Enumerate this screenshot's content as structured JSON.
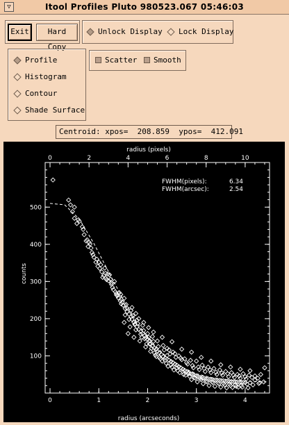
{
  "window": {
    "title": "Itool Profiles Pluto  980523.067 05:46:03",
    "menu_glyph": "▽"
  },
  "toolbar": {
    "exit_label": "Exit",
    "hardcopy_label": "Hard Copy",
    "unlock_label": "Unlock Display",
    "lock_label": "Lock Display"
  },
  "plot_types": [
    {
      "label": "Profile",
      "selected": true
    },
    {
      "label": "Histogram",
      "selected": false
    },
    {
      "label": "Contour",
      "selected": false
    },
    {
      "label": "Shade Surface",
      "selected": false
    }
  ],
  "options": {
    "scatter_label": "Scatter",
    "smooth_label": "Smooth"
  },
  "centroid": {
    "label": "Centroid:",
    "xpos_label": "xpos=",
    "xpos": "208.859",
    "ypos_label": "ypos=",
    "ypos": "412.091"
  },
  "chart_data": {
    "type": "scatter",
    "xlabel": "radius (arcseconds)",
    "ylabel": "counts",
    "top_xlabel": "radius (pixels)",
    "xlim": [
      -0.1,
      4.5
    ],
    "ylim": [
      0,
      620
    ],
    "x_ticks": [
      "0",
      "1",
      "2",
      "3",
      "4"
    ],
    "top_x_ticks": [
      "0",
      "2",
      "4",
      "6",
      "8",
      "10"
    ],
    "y_ticks": [
      "100",
      "200",
      "300",
      "400",
      "500"
    ],
    "annotations": [
      {
        "label": "FWHM(pixels):",
        "value": "6.34"
      },
      {
        "label": "FWHM(arcsec):",
        "value": "2.54"
      }
    ],
    "series": [
      {
        "points": [
          [
            0.06,
            573
          ],
          [
            0.38,
            519
          ],
          [
            0.42,
            506
          ],
          [
            0.46,
            488
          ],
          [
            0.5,
            470
          ],
          [
            0.55,
            456
          ],
          [
            0.6,
            462
          ],
          [
            0.66,
            447
          ],
          [
            0.7,
            426
          ],
          [
            0.74,
            409
          ],
          [
            0.78,
            394
          ],
          [
            0.82,
            401
          ],
          [
            0.86,
            378
          ],
          [
            0.88,
            372
          ],
          [
            0.9,
            365
          ],
          [
            0.94,
            352
          ],
          [
            0.98,
            341
          ],
          [
            1.02,
            335
          ],
          [
            1.06,
            326
          ],
          [
            1.1,
            316
          ],
          [
            1.14,
            309
          ],
          [
            1.16,
            305
          ],
          [
            1.2,
            302
          ],
          [
            1.22,
            318
          ],
          [
            1.26,
            296
          ],
          [
            1.3,
            278
          ],
          [
            1.34,
            272
          ],
          [
            1.36,
            264
          ],
          [
            1.4,
            256
          ],
          [
            1.44,
            248
          ],
          [
            1.46,
            240
          ],
          [
            1.5,
            236
          ],
          [
            1.54,
            227
          ],
          [
            1.58,
            219
          ],
          [
            1.62,
            212
          ],
          [
            1.66,
            206
          ],
          [
            1.68,
            198
          ],
          [
            1.72,
            190
          ],
          [
            1.74,
            184
          ],
          [
            1.78,
            178
          ],
          [
            1.82,
            171
          ],
          [
            1.86,
            166
          ],
          [
            1.9,
            160
          ],
          [
            1.94,
            154
          ],
          [
            1.96,
            149
          ],
          [
            2.0,
            144
          ],
          [
            2.04,
            141
          ],
          [
            2.06,
            132
          ],
          [
            2.1,
            126
          ],
          [
            2.14,
            121
          ],
          [
            2.18,
            118
          ],
          [
            2.2,
            112
          ],
          [
            2.24,
            108
          ],
          [
            2.28,
            104
          ],
          [
            2.32,
            98
          ],
          [
            2.36,
            94
          ],
          [
            2.4,
            101
          ],
          [
            2.44,
            88
          ],
          [
            2.48,
            85
          ],
          [
            2.52,
            82
          ],
          [
            2.56,
            78
          ],
          [
            2.6,
            75
          ],
          [
            2.64,
            71
          ],
          [
            2.68,
            68
          ],
          [
            2.72,
            64
          ],
          [
            2.76,
            60
          ],
          [
            2.8,
            58
          ],
          [
            2.84,
            55
          ],
          [
            2.88,
            52
          ],
          [
            2.92,
            50
          ],
          [
            2.96,
            48
          ],
          [
            3.0,
            46
          ],
          [
            3.04,
            44
          ],
          [
            3.08,
            42
          ],
          [
            3.12,
            41
          ],
          [
            3.16,
            40
          ],
          [
            3.2,
            38
          ],
          [
            3.24,
            38
          ],
          [
            3.28,
            37
          ],
          [
            3.32,
            36
          ],
          [
            3.36,
            35
          ],
          [
            3.4,
            35
          ],
          [
            3.44,
            34
          ],
          [
            3.48,
            34
          ],
          [
            3.52,
            33
          ],
          [
            3.56,
            33
          ],
          [
            3.6,
            32
          ],
          [
            3.64,
            32
          ],
          [
            3.68,
            31
          ],
          [
            3.72,
            31
          ],
          [
            3.76,
            30
          ],
          [
            3.8,
            30
          ],
          [
            3.84,
            30
          ],
          [
            3.88,
            29
          ],
          [
            3.92,
            29
          ],
          [
            3.96,
            29
          ],
          [
            4.0,
            28
          ],
          [
            4.1,
            28
          ],
          [
            4.3,
            28
          ],
          [
            0.58,
            466
          ],
          [
            0.76,
            412
          ],
          [
            0.96,
            360
          ],
          [
            1.08,
            311
          ],
          [
            1.18,
            320
          ],
          [
            1.28,
            284
          ],
          [
            1.38,
            262
          ],
          [
            1.48,
            244
          ],
          [
            1.58,
            228
          ],
          [
            1.7,
            208
          ],
          [
            1.8,
            187
          ],
          [
            1.92,
            168
          ],
          [
            2.02,
            150
          ],
          [
            2.12,
            139
          ],
          [
            2.22,
            125
          ],
          [
            2.34,
            116
          ],
          [
            2.46,
            105
          ],
          [
            2.58,
            96
          ],
          [
            2.7,
            90
          ],
          [
            2.82,
            78
          ],
          [
            2.94,
            68
          ],
          [
            3.06,
            63
          ],
          [
            3.18,
            58
          ],
          [
            3.3,
            55
          ],
          [
            3.42,
            50
          ],
          [
            3.54,
            48
          ],
          [
            3.66,
            44
          ],
          [
            3.78,
            42
          ],
          [
            3.9,
            40
          ],
          [
            4.02,
            38
          ],
          [
            4.2,
            35
          ],
          [
            1.52,
            190
          ],
          [
            1.64,
            178
          ],
          [
            1.76,
            170
          ],
          [
            1.88,
            150
          ],
          [
            1.98,
            132
          ],
          [
            2.08,
            120
          ],
          [
            2.16,
            102
          ],
          [
            2.26,
            92
          ],
          [
            2.38,
            80
          ],
          [
            2.5,
            70
          ],
          [
            2.62,
            60
          ],
          [
            2.74,
            50
          ],
          [
            2.86,
            45
          ],
          [
            2.98,
            40
          ],
          [
            3.1,
            36
          ],
          [
            3.22,
            30
          ],
          [
            3.34,
            28
          ],
          [
            3.46,
            25
          ],
          [
            3.58,
            22
          ],
          [
            3.7,
            20
          ],
          [
            3.82,
            18
          ],
          [
            3.94,
            16
          ],
          [
            4.06,
            14
          ],
          [
            1.6,
            160
          ],
          [
            1.72,
            150
          ],
          [
            1.84,
            140
          ],
          [
            1.96,
            124
          ],
          [
            2.06,
            112
          ],
          [
            2.18,
            98
          ],
          [
            2.3,
            86
          ],
          [
            2.42,
            72
          ],
          [
            2.54,
            62
          ],
          [
            2.66,
            55
          ],
          [
            2.78,
            48
          ],
          [
            2.9,
            36
          ],
          [
            3.02,
            30
          ],
          [
            3.14,
            25
          ],
          [
            3.26,
            20
          ],
          [
            3.38,
            18
          ],
          [
            3.5,
            16
          ],
          [
            3.62,
            14
          ],
          [
            3.74,
            15
          ],
          [
            3.86,
            16
          ],
          [
            2.4,
            120
          ],
          [
            2.52,
            110
          ],
          [
            2.64,
            100
          ],
          [
            2.76,
            92
          ],
          [
            2.88,
            88
          ],
          [
            3.0,
            86
          ],
          [
            3.12,
            75
          ],
          [
            3.24,
            70
          ],
          [
            3.36,
            66
          ],
          [
            3.48,
            62
          ],
          [
            3.6,
            58
          ],
          [
            3.72,
            55
          ],
          [
            3.84,
            50
          ],
          [
            3.96,
            52
          ],
          [
            4.08,
            48
          ],
          [
            4.2,
            46
          ],
          [
            4.32,
            50
          ],
          [
            4.4,
            68
          ],
          [
            0.84,
            390
          ],
          [
            1.04,
            345
          ],
          [
            1.12,
            336
          ],
          [
            1.24,
            306
          ],
          [
            1.32,
            300
          ],
          [
            1.42,
            270
          ],
          [
            1.56,
            238
          ],
          [
            1.66,
            222
          ],
          [
            1.78,
            196
          ],
          [
            1.9,
            182
          ],
          [
            2.0,
            160
          ],
          [
            2.1,
            152
          ],
          [
            2.2,
            140
          ],
          [
            2.32,
            128
          ],
          [
            2.44,
            116
          ],
          [
            2.56,
            106
          ],
          [
            2.68,
            94
          ],
          [
            2.8,
            82
          ],
          [
            2.92,
            74
          ],
          [
            3.04,
            70
          ],
          [
            3.16,
            66
          ],
          [
            3.28,
            62
          ],
          [
            3.4,
            56
          ],
          [
            3.52,
            54
          ],
          [
            3.64,
            52
          ],
          [
            3.76,
            48
          ],
          [
            3.88,
            46
          ],
          [
            4.0,
            44
          ],
          [
            4.14,
            42
          ],
          [
            4.26,
            40
          ],
          [
            0.5,
            500
          ],
          [
            0.68,
            440
          ],
          [
            0.8,
            405
          ],
          [
            1.0,
            352
          ],
          [
            1.14,
            322
          ],
          [
            1.26,
            292
          ],
          [
            1.36,
            268
          ],
          [
            1.46,
            252
          ],
          [
            1.54,
            210
          ],
          [
            1.62,
            198
          ],
          [
            1.74,
            186
          ],
          [
            1.86,
            158
          ],
          [
            1.94,
            146
          ],
          [
            2.04,
            132
          ],
          [
            2.14,
            108
          ],
          [
            2.24,
            96
          ],
          [
            2.36,
            88
          ],
          [
            2.48,
            76
          ],
          [
            2.6,
            68
          ],
          [
            2.72,
            58
          ],
          [
            2.84,
            52
          ],
          [
            2.96,
            42
          ],
          [
            3.08,
            38
          ],
          [
            3.2,
            32
          ],
          [
            3.32,
            30
          ],
          [
            3.44,
            28
          ],
          [
            3.56,
            26
          ],
          [
            3.68,
            24
          ],
          [
            3.8,
            22
          ],
          [
            3.92,
            20
          ],
          [
            4.04,
            24
          ],
          [
            4.16,
            22
          ],
          [
            4.28,
            26
          ],
          [
            4.38,
            30
          ],
          [
            1.45,
            265
          ],
          [
            1.52,
            255
          ],
          [
            1.68,
            230
          ],
          [
            1.76,
            214
          ],
          [
            1.82,
            200
          ],
          [
            1.92,
            190
          ],
          [
            2.02,
            176
          ],
          [
            2.12,
            164
          ],
          [
            2.3,
            150
          ],
          [
            2.5,
            138
          ],
          [
            2.7,
            118
          ],
          [
            2.9,
            110
          ],
          [
            3.1,
            96
          ],
          [
            3.3,
            86
          ],
          [
            3.5,
            76
          ],
          [
            3.7,
            70
          ],
          [
            3.9,
            64
          ],
          [
            4.1,
            60
          ]
        ]
      }
    ],
    "fit_curve": [
      [
        0.0,
        510
      ],
      [
        0.3,
        506
      ],
      [
        0.6,
        468
      ],
      [
        0.9,
        402
      ],
      [
        1.2,
        326
      ],
      [
        1.5,
        252
      ],
      [
        1.8,
        186
      ],
      [
        2.1,
        134
      ],
      [
        2.4,
        96
      ],
      [
        2.7,
        70
      ],
      [
        3.0,
        52
      ],
      [
        3.3,
        42
      ],
      [
        3.6,
        36
      ],
      [
        3.9,
        33
      ],
      [
        4.2,
        31
      ],
      [
        4.45,
        30
      ]
    ]
  }
}
